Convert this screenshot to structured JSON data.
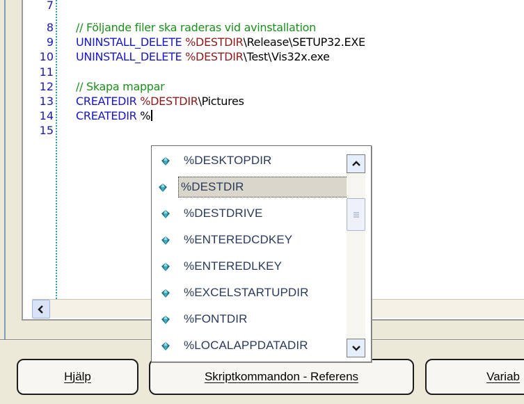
{
  "editor": {
    "lines": [
      {
        "num": "7",
        "parts": []
      },
      {
        "num": "8",
        "parts": [
          {
            "t": "// Följande filer ska raderas vid avinstallation",
            "c": "comment"
          }
        ]
      },
      {
        "num": "9",
        "parts": [
          {
            "t": "UNINSTALL_DELETE ",
            "c": "kw"
          },
          {
            "t": "%DESTDIR",
            "c": "var"
          },
          {
            "t": "\\Release\\SETUP32.EXE",
            "c": "plain"
          }
        ]
      },
      {
        "num": "10",
        "parts": [
          {
            "t": "UNINSTALL_DELETE ",
            "c": "kw"
          },
          {
            "t": "%DESTDIR",
            "c": "var"
          },
          {
            "t": "\\Test\\Vis32x.exe",
            "c": "plain"
          }
        ]
      },
      {
        "num": "11",
        "parts": []
      },
      {
        "num": "12",
        "parts": [
          {
            "t": "// Skapa mappar",
            "c": "comment"
          }
        ]
      },
      {
        "num": "13",
        "parts": [
          {
            "t": "CREATEDIR ",
            "c": "kw"
          },
          {
            "t": "%DESTDIR",
            "c": "var"
          },
          {
            "t": "\\Pictures",
            "c": "plain"
          }
        ]
      },
      {
        "num": "14",
        "parts": [
          {
            "t": "CREATEDIR ",
            "c": "kw"
          },
          {
            "t": "%",
            "c": "plain"
          }
        ]
      },
      {
        "num": "15",
        "parts": []
      }
    ]
  },
  "autocomplete": {
    "items": [
      "%DESKTOPDIR",
      "%DESTDIR",
      "%DESTDRIVE",
      "%ENTEREDCDKEY",
      "%ENTEREDLKEY",
      "%EXCELSTARTUPDIR",
      "%FONTDIR",
      "%LOCALAPPDATADIR"
    ],
    "selected_index": 1,
    "scroll_position": 0.3,
    "item_icon": "gem-icon"
  },
  "buttons": {
    "help_label": "Hjälp",
    "help_mnemonic": "j",
    "script_ref_label": "Skriptkommandon - Referens",
    "script_ref_mnemonic": "S",
    "variables_label": "Variab",
    "variables_mnemonic": "V"
  },
  "colors": {
    "keyword": "#1717c8",
    "variable": "#8b1a1a",
    "comment": "#1c8f1c",
    "line_number": "#1a1ab8",
    "gutter_dots": "#2aa6b6",
    "window_bg": "#ece9d8"
  }
}
